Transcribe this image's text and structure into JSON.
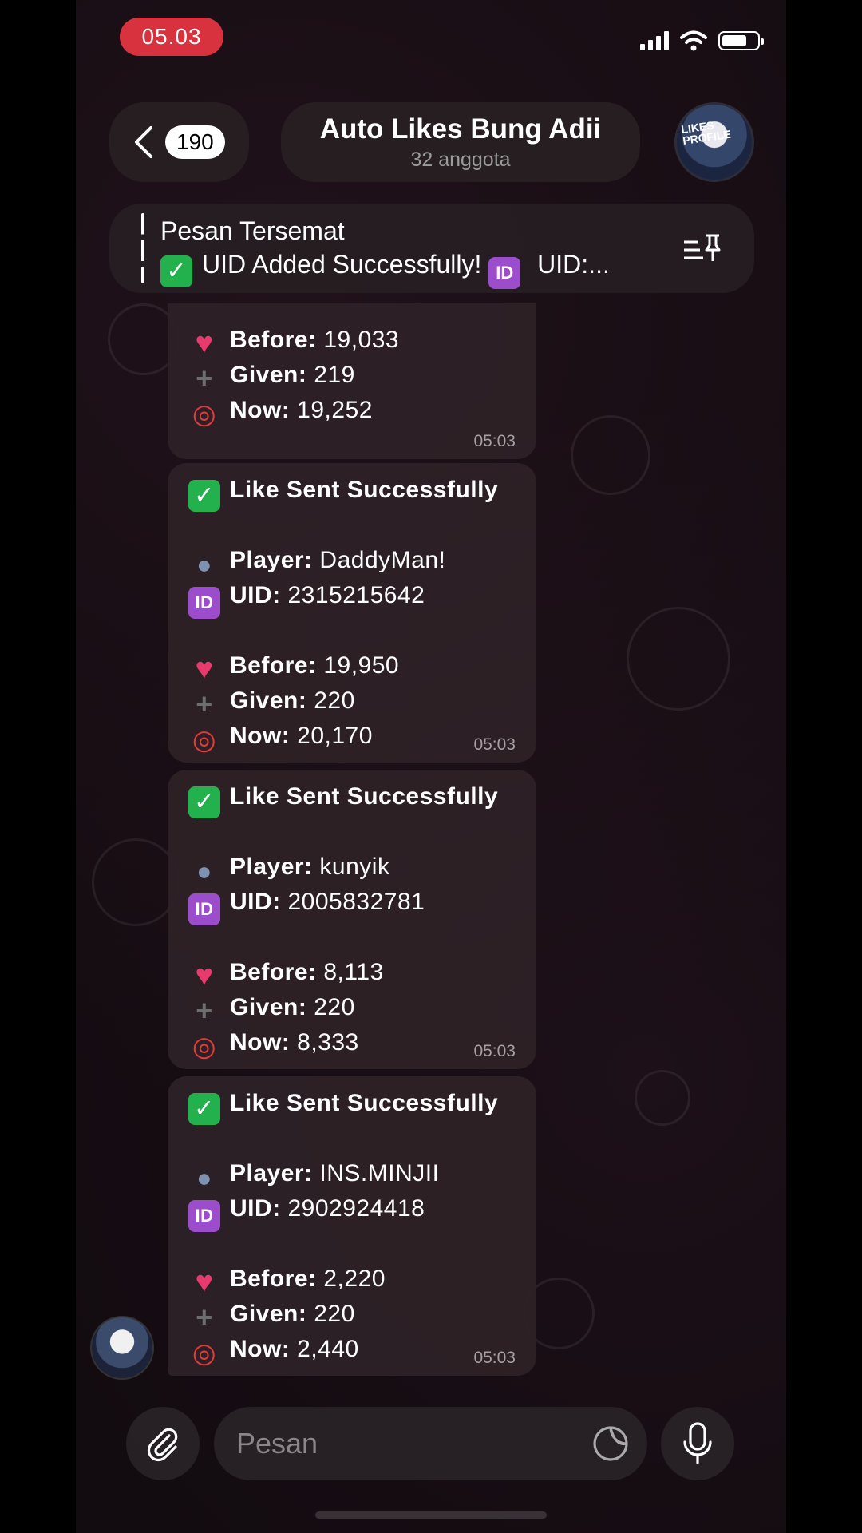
{
  "status_bar": {
    "time": "05.03"
  },
  "header": {
    "back_count": "190",
    "title": "Auto Likes Bung Adii",
    "subtitle": "32 anggota",
    "avatar_text": "LIKES PROFILE"
  },
  "pinned": {
    "title": "Pesan Tersemat",
    "text": "UID Added Successfully! ",
    "text_tail": " UID:..."
  },
  "labels": {
    "header": "Like Sent Successfully",
    "player": "Player:",
    "uid": "UID:",
    "before": "Before:",
    "given": "Given:",
    "now": "Now:",
    "id_tag": "ID"
  },
  "messages": [
    {
      "before": "19,033",
      "given": "219",
      "now": "19,252",
      "time": "05:03"
    },
    {
      "player": "DaddyMan!",
      "uid": "2315215642",
      "before": "19,950",
      "given": "220",
      "now": "20,170",
      "time": "05:03"
    },
    {
      "player": "kunyik",
      "uid": "2005832781",
      "before": "8,113",
      "given": "220",
      "now": "8,333",
      "time": "05:03"
    },
    {
      "player": "INS.MINJII",
      "uid": "2902924418",
      "before": "2,220",
      "given": "220",
      "now": "2,440",
      "time": "05:03"
    }
  ],
  "composer": {
    "placeholder": "Pesan"
  },
  "icons": {
    "status": [
      "signal-icon",
      "wifi-icon",
      "battery-icon"
    ],
    "pinned": "pin-list-icon",
    "composer": [
      "attach-icon",
      "sticker-icon",
      "microphone-icon"
    ]
  }
}
